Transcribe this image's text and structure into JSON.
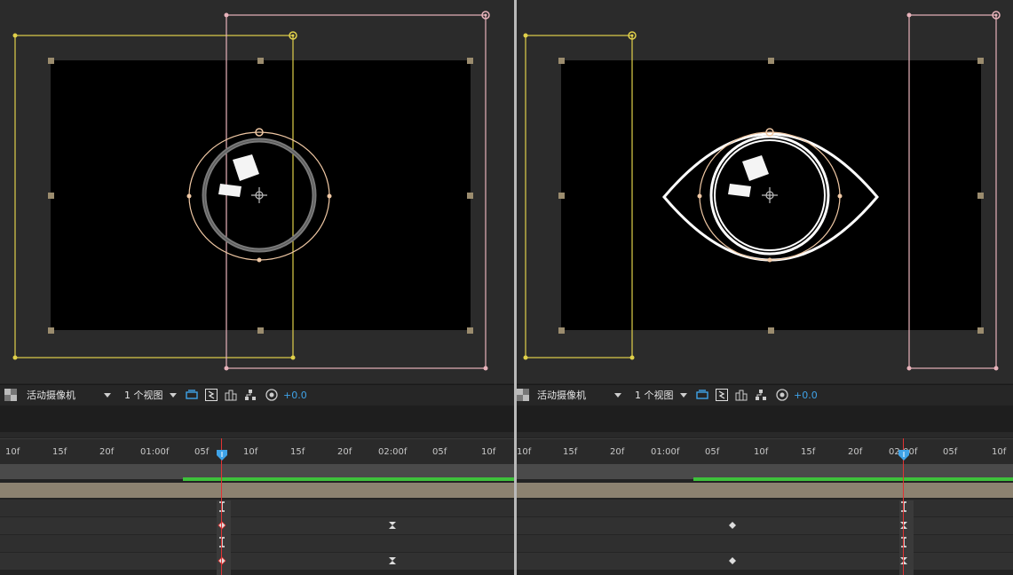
{
  "left": {
    "camera": {
      "label": "活动摄像机"
    },
    "views": {
      "label": "1 个视图"
    },
    "exposure": {
      "value": "+0.0"
    },
    "ruler": [
      "10f",
      "15f",
      "20f",
      "01:00f",
      "05f",
      "10f",
      "15f",
      "20f",
      "02:00f",
      "05f",
      "10f"
    ]
  },
  "right": {
    "camera": {
      "label": "活动摄像机"
    },
    "views": {
      "label": "1 个视图"
    },
    "exposure": {
      "value": "+0.0"
    },
    "ruler": [
      "10f",
      "15f",
      "20f",
      "01:00f",
      "05f",
      "10f",
      "15f",
      "20f",
      "02:00f",
      "05f",
      "10f"
    ]
  },
  "colors": {
    "camera_outline": "#e0d04a",
    "light_outline": "#e8b3bb",
    "shape_path": "#f0c8a4",
    "green_bar": "#3ec13b",
    "cti": "#e23333",
    "cti_head": "#3fa3e8",
    "layer_bar": "#8c8270"
  },
  "icons": [
    "transparency-grid-icon",
    "fast-preview-icon",
    "timeline-icon",
    "comp-flowchart-icon",
    "snapshot-icon",
    "exposure-icon"
  ]
}
